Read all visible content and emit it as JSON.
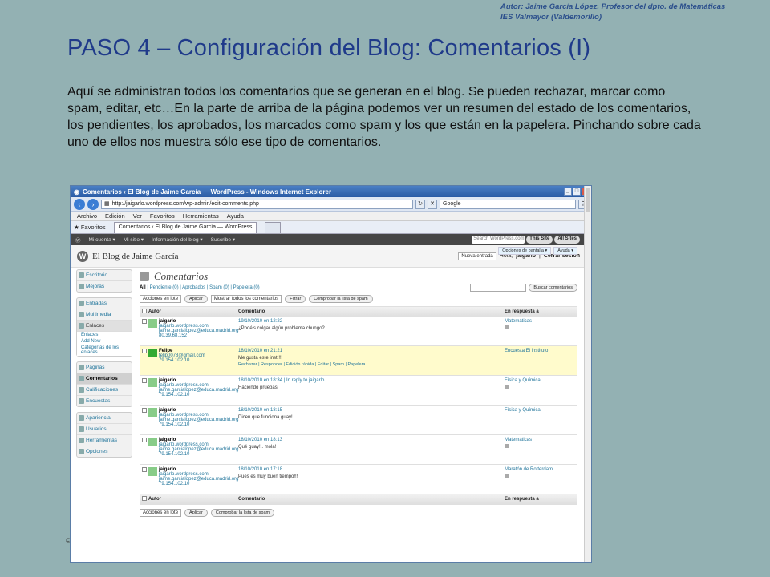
{
  "slide": {
    "author_line1": "Autor: Jaime García López. Profesor del dpto. de Matemáticas",
    "author_line2": "IES Valmayor (Valdemorillo)",
    "title": "PASO 4 – Configuración del Blog: Comentarios (I)",
    "text": "Aquí se administran todos los comentarios que se generan en el blog. Se pueden rechazar, marcar como spam, editar, etc…En la parte de arriba de la página podemos ver un resumen del estado de los comentarios, los pendientes, los aprobados, los marcados como spam y los que están en la papelera. Pinchando sobre cada uno de ellos nos muestra sólo ese tipo de comentarios.",
    "copyright": "©"
  },
  "browser": {
    "window_title": "Comentarios ‹ El Blog de Jaime García — WordPress - Windows Internet Explorer",
    "url": "http://jaigarlo.wordpress.com/wp-admin/edit-comments.php",
    "search_placeholder": "Google",
    "menu": [
      "Archivo",
      "Edición",
      "Ver",
      "Favoritos",
      "Herramientas",
      "Ayuda"
    ],
    "favorites_label": "Favoritos",
    "tab_label": "Comentarios ‹ El Blog de Jaime García — WordPress"
  },
  "adminbar": {
    "items": [
      "Mi cuenta ▾",
      "Mi sitio ▾",
      "Información del blog ▾",
      "Suscribe ▾"
    ],
    "search_placeholder": "Search WordPress.com",
    "this_site": "This Site",
    "all_sites": "All Sites"
  },
  "header": {
    "blog_name": "El Blog de Jaime García",
    "new_entry": "Nueva entrada",
    "greeting": "Hola,",
    "user": "jaigarlo",
    "logout": "Cerrar sesión",
    "screen_options": "Opciones de pantalla ▾",
    "help": "Ayuda ▾"
  },
  "sidebar": {
    "group1": [
      "Escritorio",
      "Mejoras"
    ],
    "group2": [
      "Entradas",
      "Multimedia"
    ],
    "links_label": "Enlaces",
    "links_sub": [
      "Enlaces",
      "Add New",
      "Categorías de los enlaces"
    ],
    "group3": [
      "Páginas",
      "Comentarios",
      "Calificaciones",
      "Encuestas"
    ],
    "group4": [
      "Apariencia",
      "Usuarios",
      "Herramientas",
      "Opciones"
    ]
  },
  "page": {
    "title": "Comentarios",
    "filter_all": "All",
    "filter_rest": "| Pendiente (0) | Aprobados | Spam (0) | Papelera (0)",
    "search_button": "Buscar comentarios",
    "bulk_label": "Acciones en lote",
    "apply": "Aplicar",
    "show_all": "Mostrar todos los comentarios",
    "filter_btn": "Filtrar",
    "check_spam": "Comprobar la lista de spam"
  },
  "table": {
    "col_author": "Autor",
    "col_comment": "Comentario",
    "col_response": "En respuesta a",
    "rows": [
      {
        "author": "jaigarlo",
        "link": "jaigarlo.wordpress.com",
        "email": "jaime.garcialopez@educa.madrid.org",
        "ip": "80.39.68.152",
        "date": "19/10/2010 en 12:22",
        "text": "¿Podéis colgar algún problema chungo?",
        "post": "Matemáticas",
        "actions": ""
      },
      {
        "author": "Felipe",
        "link": "",
        "email": "felip0078@gmail.com",
        "ip": "79.154.102.10",
        "date": "18/10/2010 en 21:21",
        "text": "Me gusta este inst!!!",
        "post": "Encuesta El instituto",
        "actions": "Rechazar | Responder | Edición rápida | Editar | Spam | Papelera"
      },
      {
        "author": "jaigarlo",
        "link": "jaigarlo.wordpress.com",
        "email": "jaime.garcialopez@educa.madrid.org",
        "ip": "79.154.102.10",
        "date": "18/10/2010 en 18:34 | In reply to jaigarlo.",
        "text": "Haciendo pruebas",
        "post": "Física y Química",
        "actions": ""
      },
      {
        "author": "jaigarlo",
        "link": "jaigarlo.wordpress.com",
        "email": "jaime.garcialopez@educa.madrid.org",
        "ip": "79.154.102.10",
        "date": "18/10/2010 en 18:15",
        "text": "Dicen que funciona guay!",
        "post": "Física y Química",
        "actions": ""
      },
      {
        "author": "jaigarlo",
        "link": "jaigarlo.wordpress.com",
        "email": "jaime.garcialopez@educa.madrid.org",
        "ip": "79.154.102.10",
        "date": "18/10/2010 en 18:13",
        "text": "Qué guay!.. mola!",
        "post": "Matemáticas",
        "actions": ""
      },
      {
        "author": "jaigarlo",
        "link": "jaigarlo.wordpress.com",
        "email": "jaime.garcialopez@educa.madrid.org",
        "ip": "79.154.102.10",
        "date": "18/10/2010 en 17:18",
        "text": "Pues es muy buen tiempo!!!",
        "post": "Maratón de Rotterdam",
        "actions": ""
      }
    ]
  }
}
